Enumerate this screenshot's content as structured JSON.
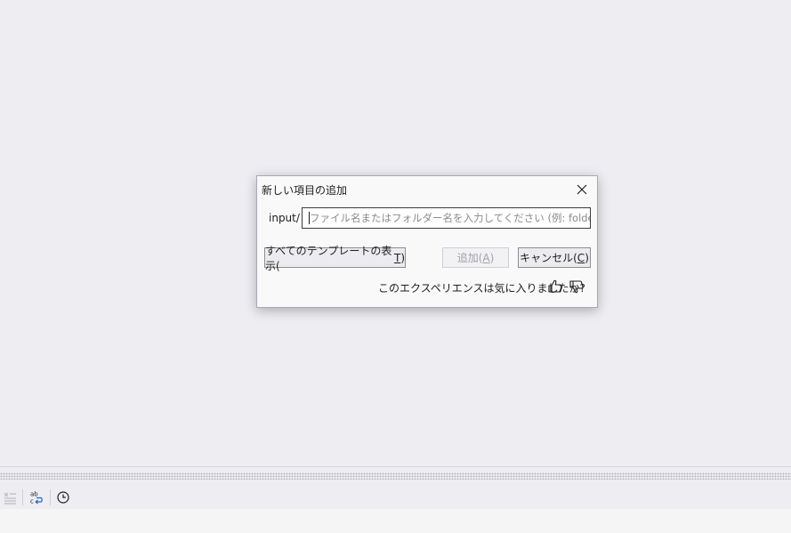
{
  "dialog": {
    "title": "新しい項目の追加",
    "path_prefix": "input/",
    "name_input": {
      "value": "",
      "placeholder": "ファイル名またはフォルダー名を入力してください (例: folder/file.cs)"
    },
    "buttons": {
      "show_all_templates": {
        "text": "すべてのテンプレートの表示(",
        "mnemonic": "T",
        "suffix": ")"
      },
      "add": {
        "text": "追加(",
        "mnemonic": "A",
        "suffix": ")",
        "enabled": false
      },
      "cancel": {
        "text": "キャンセル(",
        "mnemonic": "C",
        "suffix": ")"
      }
    },
    "feedback": {
      "question": "このエクスペリエンスは気に入りましたか?",
      "like_icon": "thumbs-up-icon",
      "dislike_icon": "thumbs-down-icon"
    },
    "close_icon": "close-icon"
  },
  "bottom_toolbar": {
    "icons": [
      "clear-all-icon",
      "word-wrap-icon",
      "clock-icon"
    ]
  },
  "colors": {
    "workspace_bg": "#eeedf2",
    "dialog_bg": "#f9f9f9",
    "input_border": "#3c3c3c",
    "accent_blue": "#1c66c7"
  }
}
